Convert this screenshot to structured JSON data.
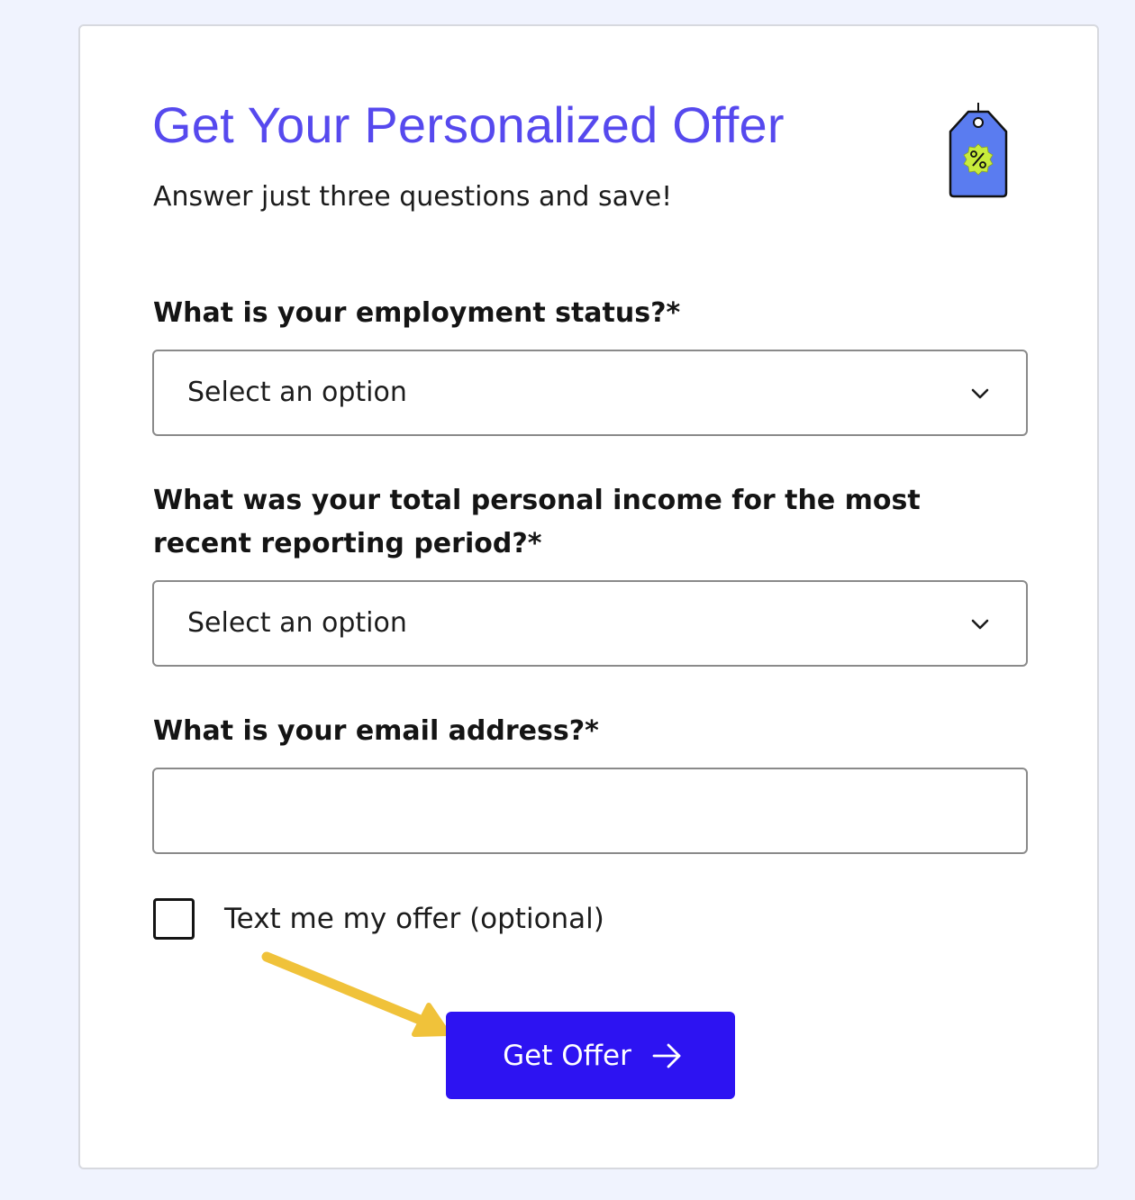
{
  "offer_form": {
    "title": "Get Your Personalized Offer",
    "subtitle": "Answer just three questions and save!",
    "tag_icon": "percent-price-tag-icon",
    "questions": [
      {
        "label": "What is your employment status?*",
        "type": "select",
        "value": "Select an option",
        "icon": "chevron-down-icon"
      },
      {
        "label": "What was your total personal income for the most recent reporting period?*",
        "type": "select",
        "value": "Select an option",
        "icon": "chevron-down-icon"
      },
      {
        "label": "What is your email address?*",
        "type": "email",
        "value": "",
        "placeholder": ""
      }
    ],
    "sms_opt_in": {
      "label": "Text me my offer (optional)",
      "checked": false
    },
    "submit": {
      "label": "Get Offer",
      "icon": "arrow-right-icon"
    }
  },
  "annotation": {
    "icon": "yellow-pointer-arrow-icon"
  },
  "colors": {
    "page_background": "#f0f3fe",
    "title": "#5649ee",
    "button": "#2d13f2",
    "annotation_arrow": "#f0c23a",
    "tag_blue": "#5a7cf0",
    "tag_badge": "#c8ec3c"
  }
}
